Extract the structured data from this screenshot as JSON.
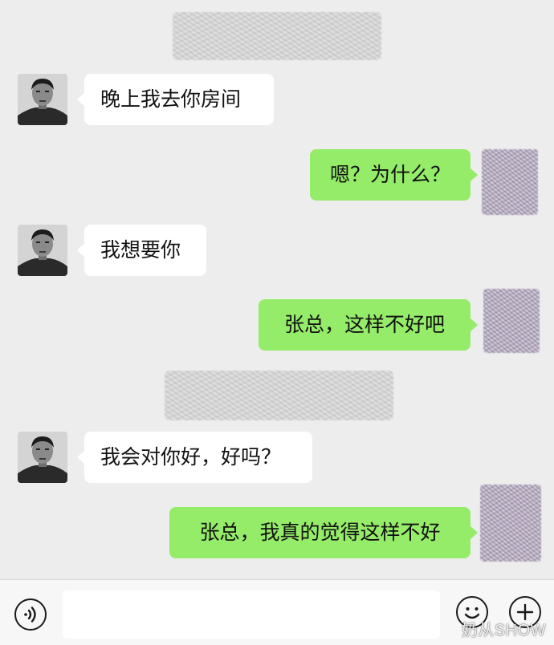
{
  "chat": {
    "messages": [
      {
        "side": "left",
        "text": "晚上我去你房间"
      },
      {
        "side": "right",
        "text": "嗯？为什么？"
      },
      {
        "side": "left",
        "text": "我想要你"
      },
      {
        "side": "right",
        "text": "张总，这样不好吧"
      },
      {
        "side": "left",
        "text": "我会对你好，好吗？"
      },
      {
        "side": "right",
        "text": "张总，我真的觉得这样不好"
      }
    ]
  },
  "input_bar": {
    "voice_icon": "voice-icon",
    "emoji_icon": "emoji-icon",
    "plus_icon": "plus-icon",
    "text_value": ""
  },
  "watermark": {
    "text": "奶从SHOW"
  },
  "colors": {
    "background": "#ededed",
    "incoming_bubble": "#ffffff",
    "outgoing_bubble": "#95ec69"
  }
}
